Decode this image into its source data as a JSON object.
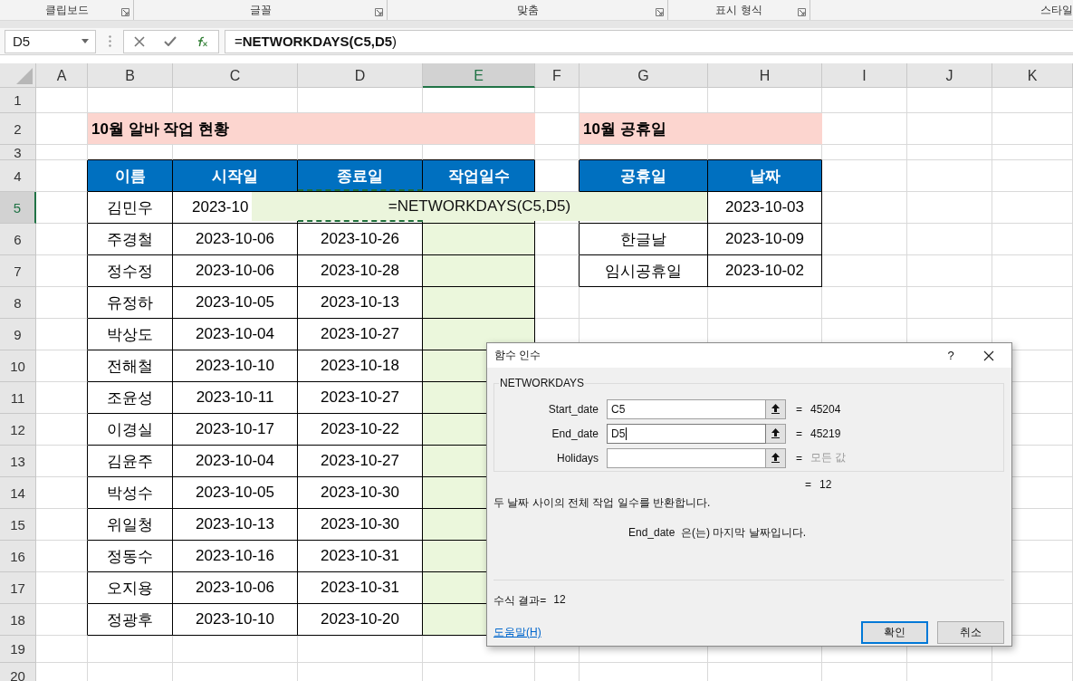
{
  "ribbon_groups": [
    {
      "label": "클립보드",
      "launcher": true
    },
    {
      "label": "글꼴",
      "launcher": true
    },
    {
      "label": "맞춤",
      "launcher": true
    },
    {
      "label": "표시 형식",
      "launcher": true
    },
    {
      "label": "스타일",
      "launcher": false
    }
  ],
  "formula_bar": {
    "name_box": "D5",
    "formula": "=**NETWORKDAYS(C5,D5**)"
  },
  "sheet": {
    "column_headers": [
      {
        "label": "A",
        "selected": false
      },
      {
        "label": "B",
        "selected": false
      },
      {
        "label": "C",
        "selected": false
      },
      {
        "label": "D",
        "selected": false
      },
      {
        "label": "E",
        "selected": true
      },
      {
        "label": "F",
        "selected": false
      },
      {
        "label": "G",
        "selected": false
      },
      {
        "label": "H",
        "selected": false
      },
      {
        "label": "I",
        "selected": false
      },
      {
        "label": "J",
        "selected": false
      },
      {
        "label": "K",
        "selected": false
      }
    ],
    "row_headers": [
      {
        "label": "1",
        "selected": false
      },
      {
        "label": "2",
        "selected": false
      },
      {
        "label": "3",
        "selected": false
      },
      {
        "label": "4",
        "selected": false
      },
      {
        "label": "5",
        "selected": true
      },
      {
        "label": "6",
        "selected": false
      },
      {
        "label": "7",
        "selected": false
      },
      {
        "label": "8",
        "selected": false
      },
      {
        "label": "9",
        "selected": false
      },
      {
        "label": "10",
        "selected": false
      },
      {
        "label": "11",
        "selected": false
      },
      {
        "label": "12",
        "selected": false
      },
      {
        "label": "13",
        "selected": false
      },
      {
        "label": "14",
        "selected": false
      },
      {
        "label": "15",
        "selected": false
      },
      {
        "label": "16",
        "selected": false
      },
      {
        "label": "17",
        "selected": false
      },
      {
        "label": "18",
        "selected": false
      },
      {
        "label": "19",
        "selected": false
      },
      {
        "label": "20",
        "selected": false
      }
    ]
  },
  "work_title": "10월 알바 작업 현황",
  "work_table": {
    "columns": [
      "이름",
      "시작일",
      "종료일",
      "작업일수"
    ],
    "rows": [
      {
        "name": "김민우",
        "start": "2023-10"
      },
      {
        "name": "주경철",
        "start": "2023-10-06",
        "end": "2023-10-26"
      },
      {
        "name": "정수정",
        "start": "2023-10-06",
        "end": "2023-10-28"
      },
      {
        "name": "유정하",
        "start": "2023-10-05",
        "end": "2023-10-13"
      },
      {
        "name": "박상도",
        "start": "2023-10-04",
        "end": "2023-10-27"
      },
      {
        "name": "전해철",
        "start": "2023-10-10",
        "end": "2023-10-18"
      },
      {
        "name": "조윤성",
        "start": "2023-10-11",
        "end": "2023-10-27"
      },
      {
        "name": "이경실",
        "start": "2023-10-17",
        "end": "2023-10-22"
      },
      {
        "name": "김윤주",
        "start": "2023-10-04",
        "end": "2023-10-27"
      },
      {
        "name": "박성수",
        "start": "2023-10-05",
        "end": "2023-10-30"
      },
      {
        "name": "위일청",
        "start": "2023-10-13",
        "end": "2023-10-30"
      },
      {
        "name": "정동수",
        "start": "2023-10-16",
        "end": "2023-10-31"
      },
      {
        "name": "오지용",
        "start": "2023-10-06",
        "end": "2023-10-31"
      },
      {
        "name": "정광후",
        "start": "2023-10-10",
        "end": "2023-10-20"
      }
    ]
  },
  "holiday_title": "10월 공휴일",
  "holiday_table": {
    "columns": [
      "공휴일",
      "날짜"
    ],
    "rows": [
      {
        "date": "2023-10-03"
      },
      {
        "name": "한글날",
        "date": "2023-10-09"
      },
      {
        "name": "임시공휴일",
        "date": "2023-10-02"
      }
    ]
  },
  "cell_editor": {
    "formula": "=NETWORKDAYS(C5,D5)"
  },
  "dialog": {
    "title": "함수 인수",
    "help_glyph": "?",
    "function_name": "NETWORKDAYS",
    "arguments": [
      {
        "label": "Start_date",
        "value": "C5",
        "result": "45204",
        "focused": false,
        "dimmed": false
      },
      {
        "label": "End_date",
        "value": "D5",
        "result": "45219",
        "focused": true,
        "dimmed": false
      },
      {
        "label": "Holidays",
        "result": "모든 값",
        "focused": false,
        "dimmed": true
      }
    ],
    "equals": "=",
    "total_result": "12",
    "description": "두 날짜 사이의 전체 작업 일수를 반환합니다.",
    "argument_description": "End_date  은(는) 마지막 날짜입니다.",
    "formula_result_label": "수식 결과=",
    "formula_result": "12",
    "help_link": "도움말(H)",
    "buttons": [
      {
        "label": "확인",
        "default": true
      },
      {
        "label": "취소",
        "default": false
      }
    ]
  }
}
